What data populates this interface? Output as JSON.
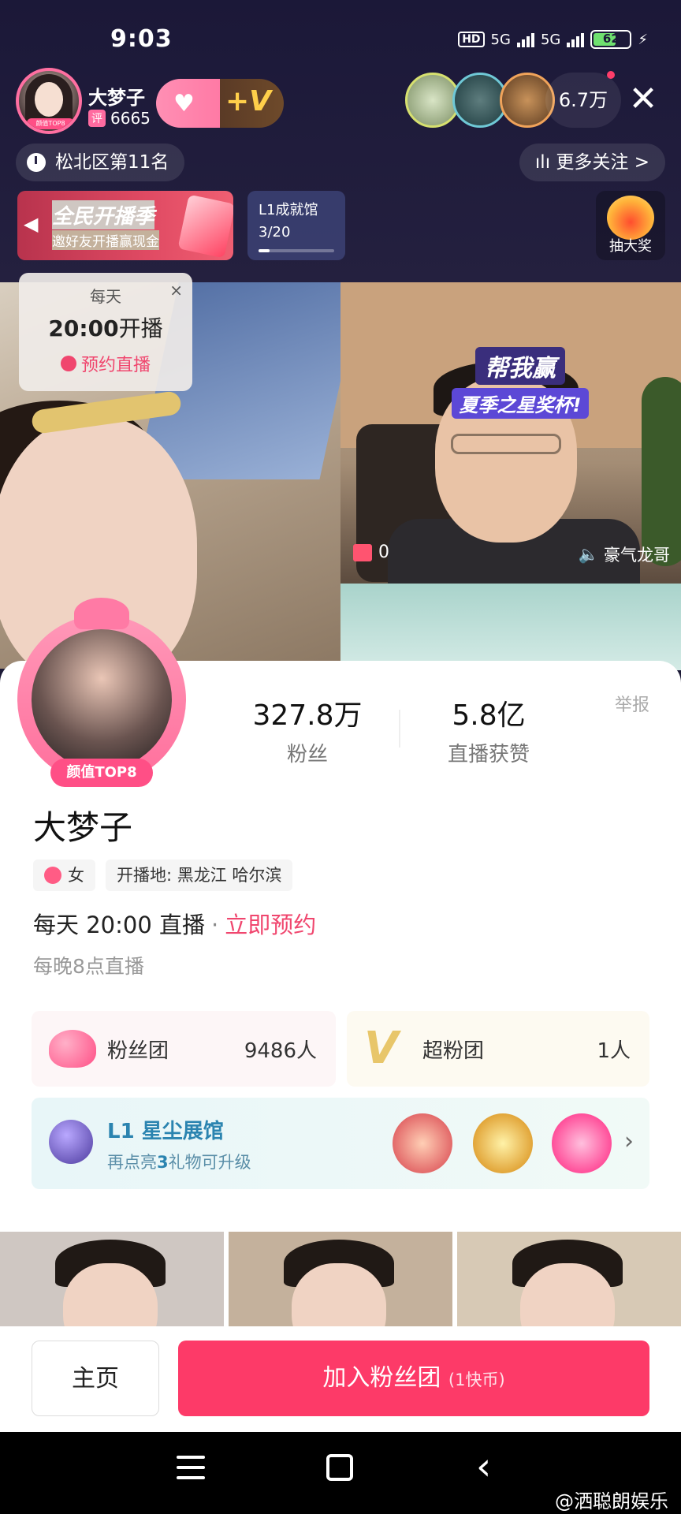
{
  "status_bar": {
    "time": "9:03",
    "hd": "HD",
    "net1": "5G",
    "net2": "5G",
    "battery": "62",
    "battery_level": 0.62
  },
  "host": {
    "name": "大梦子",
    "score_tag": "评",
    "score": "6665",
    "badge": "颜值TOP8"
  },
  "viewers": {
    "count": "6.7万"
  },
  "rank": {
    "text": "松北区第11名"
  },
  "more_follow": {
    "label": "更多关注 >"
  },
  "promo": {
    "title": "全民开播季",
    "subtitle": "邀好友开播赢现金"
  },
  "achievement": {
    "title": "L1成就馆",
    "progress_text": "3/20",
    "progress": 0.15
  },
  "lottery": {
    "label": "抽大奖"
  },
  "reserve_card": {
    "freq": "每天",
    "time": "20:00",
    "suffix": "开播",
    "action": "预约直播",
    "close": "×"
  },
  "guest_video": {
    "banner_line1": "帮我赢",
    "banner_line2": "夏季之星奖杯!",
    "gift_count": "0",
    "guest_name": "豪气龙哥"
  },
  "profile": {
    "avatar_tag": "颜值TOP8",
    "followers": "327.8万",
    "followers_label": "粉丝",
    "likes": "5.8亿",
    "likes_label": "直播获赞",
    "report": "举报",
    "name": "大梦子",
    "sex": "女",
    "location": "开播地: 黑龙江 哈尔滨",
    "schedule": "每天 20:00 直播",
    "schedule_dot": "·",
    "reserve_link": "立即预约",
    "note": "每晚8点直播"
  },
  "fan_group": {
    "label": "粉丝团",
    "count": "9486人"
  },
  "super_fans": {
    "label": "超粉团",
    "count": "1人"
  },
  "gallery": {
    "title": "L1 星尘展馆",
    "hint_prefix": "再点亮",
    "hint_num": "3",
    "hint_suffix": "礼物可升级"
  },
  "bottom": {
    "home": "主页",
    "join": "加入粉丝团",
    "join_sub": "(1快币)"
  },
  "watermark": "@洒聪朗娱乐"
}
